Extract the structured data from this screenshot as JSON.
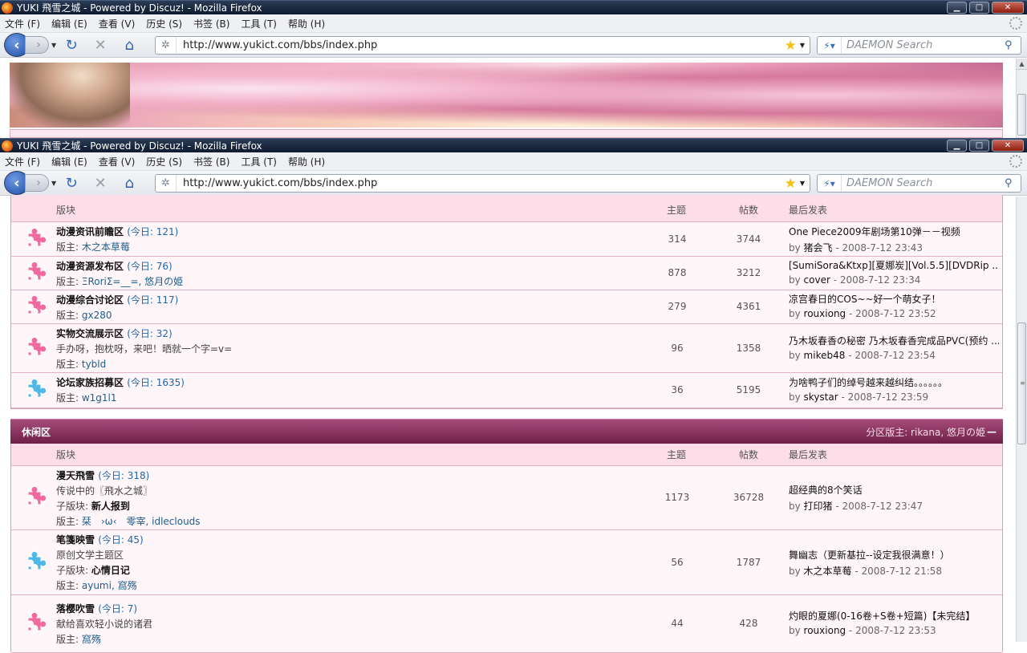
{
  "window": {
    "title": "YUKI 飛雪之城 - Powered by Discuz! - Mozilla Firefox",
    "min": "▁",
    "max": "□",
    "close": "✕"
  },
  "menu": [
    "文件 (F)",
    "编辑 (E)",
    "查看 (V)",
    "历史 (S)",
    "书签 (B)",
    "工具 (T)",
    "帮助 (H)"
  ],
  "nav": {
    "url": "http://www.yukict.com/bbs/index.php",
    "search_placeholder": "DAEMON Search"
  },
  "header_cols": {
    "name": "版块",
    "topics": "主题",
    "posts": "帖数",
    "last": "最后发表"
  },
  "section1": {
    "rows": [
      {
        "name": "动漫资讯前瞻区",
        "today": "(今日: 121)",
        "line2": "版主: ",
        "mods": "木之本草莓",
        "topics": "314",
        "posts": "3744",
        "last_title": "One Piece2009年剧场第10弹－－视频",
        "last_by": "by ",
        "last_user": "猪会飞",
        "last_time": " - 2008-7-12 23:43",
        "icon_color": "#f06aa0"
      },
      {
        "name": "动漫资源发布区",
        "today": "(今日: 76)",
        "line2": "版主: ",
        "mods": "ΞRoriΣ=__=, 悠月の姫",
        "topics": "878",
        "posts": "3212",
        "last_title": "[SumiSora&Ktxp][夏娜炭][Vol.5.5][DVDRip ...",
        "last_by": "by ",
        "last_user": "cover",
        "last_time": " - 2008-7-12 23:34",
        "icon_color": "#f06aa0"
      },
      {
        "name": "动漫综合讨论区",
        "today": "(今日: 117)",
        "line2": "版主: ",
        "mods": "gx280",
        "topics": "279",
        "posts": "4361",
        "last_title": "凉宫春日的COS~~好一个萌女子！",
        "last_by": "by ",
        "last_user": "rouxiong",
        "last_time": " - 2008-7-12 23:52",
        "icon_color": "#f06aa0"
      },
      {
        "name": "实物交流展示区",
        "today": "(今日: 32)",
        "desc": "手办呀，抱枕呀，来吧！晒就一个字=v=",
        "line2": "版主: ",
        "mods": "tybld",
        "topics": "96",
        "posts": "1358",
        "last_title": "乃木坂春香の秘密 乃木坂春香完成品PVC(预约 ...",
        "last_by": "by ",
        "last_user": "mikeb48",
        "last_time": " - 2008-7-12 23:54",
        "icon_color": "#f06aa0"
      },
      {
        "name": "论坛家族招募区",
        "today": "(今日: 1635)",
        "line2": "版主: ",
        "mods": "w1g1l1",
        "topics": "36",
        "posts": "5195",
        "last_title": "为啥鸭子们的绰号越来越纠结。。。。。。",
        "last_by": "by ",
        "last_user": "skystar",
        "last_time": " - 2008-7-12 23:59",
        "icon_color": "#4fb8e8"
      }
    ]
  },
  "section2": {
    "title": "休闲区",
    "moderators": "分区版主: rikana, 悠月の姫",
    "collapse": "—",
    "rows": [
      {
        "name": "漫天飛雪",
        "today": "(今日: 318)",
        "desc": "传说中的〖飛水之城〗",
        "sub": "子版块: ",
        "sub_val": "新人报到",
        "line2": "版主: ",
        "mods": "栞　›ω‹　零宰, idleclouds",
        "topics": "1173",
        "posts": "36728",
        "last_title": "超经典的8个笑话",
        "last_by": "by ",
        "last_user": "打印猪",
        "last_time": " - 2008-7-12 23:47",
        "icon_color": "#f06aa0"
      },
      {
        "name": "笔箋映雪",
        "today": "(今日: 45)",
        "desc": "原创文学主题区",
        "sub": "子版块: ",
        "sub_val": "心情日记",
        "line2": "版主: ",
        "mods": "ayumi, 窩殇",
        "topics": "56",
        "posts": "1787",
        "last_title": "舞幽志（更新基拉--设定我很满意！）",
        "last_by": "by ",
        "last_user": "木之本草莓",
        "last_time": " - 2008-7-12 21:58",
        "icon_color": "#4fb8e8"
      },
      {
        "name": "落樱吹雪",
        "today": "(今日: 7)",
        "desc": "献给喜欢轻小说的诸君",
        "line2": "版主: ",
        "mods": "窩殇",
        "topics": "44",
        "posts": "428",
        "last_title": "灼眼的夏娜(0-16卷+S卷+短篇)【未完结】",
        "last_by": "by ",
        "last_user": "rouxiong",
        "last_time": " - 2008-7-12 23:53",
        "icon_color": "#f06aa0"
      }
    ]
  }
}
